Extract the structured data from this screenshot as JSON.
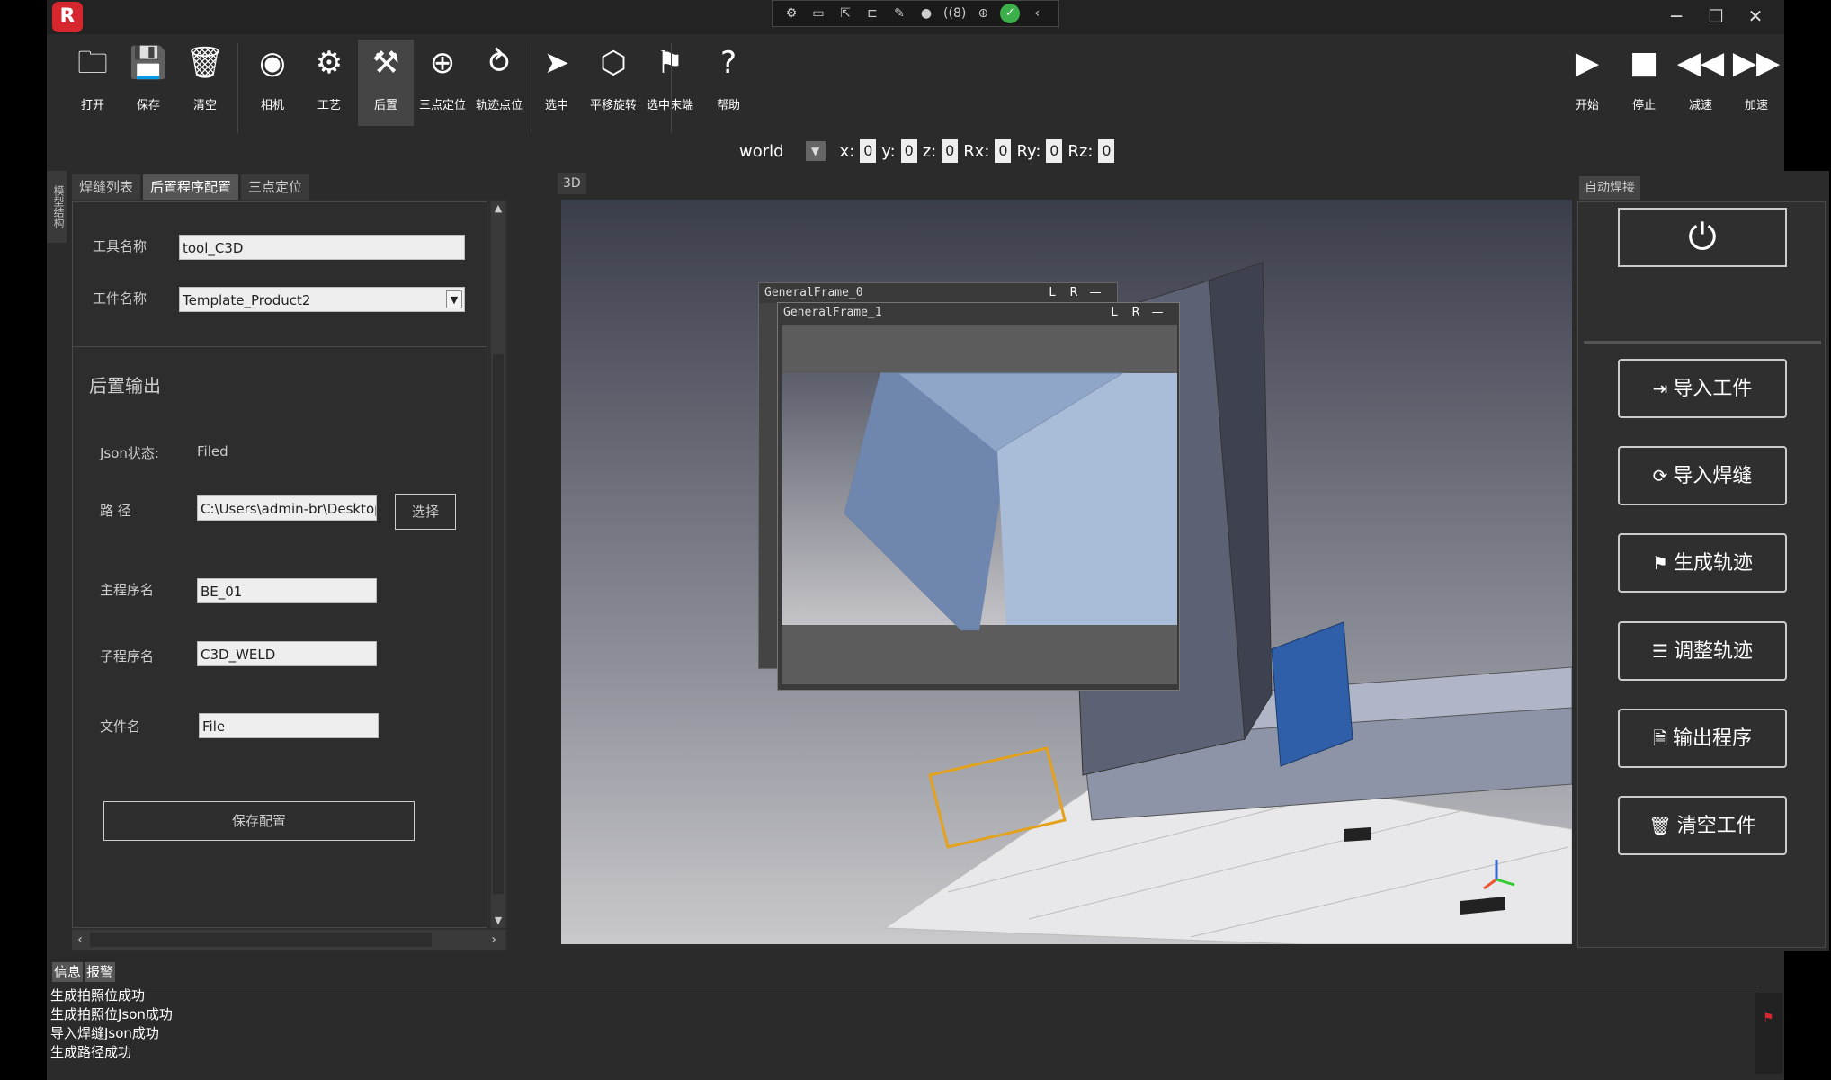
{
  "titlebar": {
    "logo_letter": "R",
    "minimize": "─",
    "maximize": "☐",
    "close": "✕",
    "strip_badge": "8"
  },
  "toolbar": {
    "items": [
      {
        "label": "打开",
        "icon": "folder-icon"
      },
      {
        "label": "保存",
        "icon": "save-icon"
      },
      {
        "label": "清空",
        "icon": "trash-icon"
      },
      {
        "label": "相机",
        "icon": "camera-icon"
      },
      {
        "label": "工艺",
        "icon": "process-icon"
      },
      {
        "label": "后置",
        "icon": "robot-arm-icon"
      },
      {
        "label": "三点定位",
        "icon": "target-icon"
      },
      {
        "label": "轨迹点位",
        "icon": "path-icon"
      },
      {
        "label": "选中",
        "icon": "cursor-icon"
      },
      {
        "label": "平移旋转",
        "icon": "cube-icon"
      },
      {
        "label": "选中末端",
        "icon": "end-effector-icon"
      },
      {
        "label": "帮助",
        "icon": "help-icon"
      }
    ],
    "playback": [
      {
        "label": "开始",
        "icon": "play-icon"
      },
      {
        "label": "停止",
        "icon": "stop-icon"
      },
      {
        "label": "减速",
        "icon": "rewind-icon"
      },
      {
        "label": "加速",
        "icon": "fast-forward-icon"
      }
    ]
  },
  "coords": {
    "frame": "world",
    "x_label": "x:",
    "x": "0",
    "y_label": "y:",
    "y": "0",
    "z_label": "z:",
    "z": "0",
    "rx_label": "Rx:",
    "rx": "0",
    "ry_label": "Ry:",
    "ry": "0",
    "rz_label": "Rz:",
    "rz": "0"
  },
  "side_strip": "模型结构",
  "left_panel": {
    "tabs": [
      "焊缝列表",
      "后置程序配置",
      "三点定位"
    ],
    "tool_name_label": "工具名称",
    "tool_name_value": "tool_C3D",
    "workpiece_label": "工件名称",
    "workpiece_value": "Template_Product2",
    "section_title": "后置输出",
    "json_status_label": "Json状态:",
    "json_status_value": "Filed",
    "path_label": "路 径",
    "path_value": "C:\\Users\\admin-br\\Desktop",
    "select_button": "选择",
    "main_program_label": "主程序名",
    "main_program_value": "BE_01",
    "sub_program_label": "子程序名",
    "sub_program_value": "C3D_WELD",
    "file_name_label": "文件名",
    "file_name_value": "File",
    "save_button": "保存配置"
  },
  "view3d": {
    "tab": "3D",
    "frame0_title": "GeneralFrame_0",
    "frame1_title": "GeneralFrame_1",
    "frame_btn_l": "L",
    "frame_btn_r": "R",
    "frame_btn_min": "—"
  },
  "right_panel": {
    "tab": "自动焊接",
    "power_icon": "power-icon",
    "buttons": [
      {
        "label": "导入工件",
        "icon": "import-icon"
      },
      {
        "label": "导入焊缝",
        "icon": "import-weld-icon"
      },
      {
        "label": "生成轨迹",
        "icon": "trajectory-icon"
      },
      {
        "label": "调整轨迹",
        "icon": "adjust-icon"
      },
      {
        "label": "输出程序",
        "icon": "export-icon"
      },
      {
        "label": "清空工件",
        "icon": "trash-icon"
      }
    ]
  },
  "bottom": {
    "tabs": [
      "信息",
      "报警"
    ],
    "log": [
      "生成拍照位成功",
      "生成拍照位Json成功",
      "导入焊缝Json成功",
      "生成路径成功"
    ]
  }
}
